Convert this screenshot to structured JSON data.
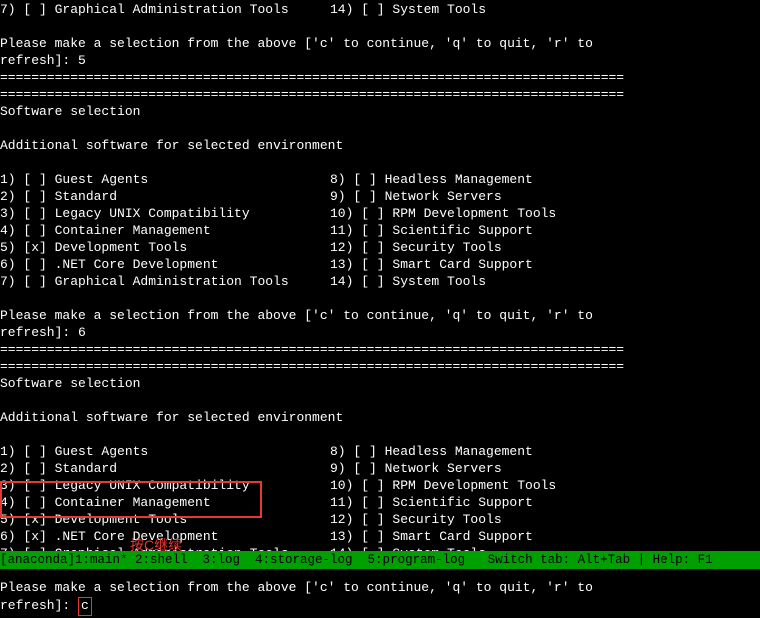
{
  "top_fragment": {
    "item7": "7) [ ] Graphical Administration Tools",
    "item14": "14) [ ] System Tools"
  },
  "prompt_line1": "Please make a selection from the above ['c' to continue, 'q' to quit, 'r' to",
  "prompt_refresh5": "refresh]: 5",
  "prompt_refresh6": "refresh]: 6",
  "prompt_refresh_c": "refresh]: ",
  "cursor_c": "c",
  "divider": "================================================================================",
  "section_title": "Software selection",
  "section_subtitle": "Additional software for selected environment",
  "list1": {
    "left": [
      "1) [ ] Guest Agents",
      "2) [ ] Standard",
      "3) [ ] Legacy UNIX Compatibility",
      "4) [ ] Container Management",
      "5) [x] Development Tools",
      "6) [ ] .NET Core Development",
      "7) [ ] Graphical Administration Tools"
    ],
    "right": [
      "8) [ ] Headless Management",
      "9) [ ] Network Servers",
      "10) [ ] RPM Development Tools",
      "11) [ ] Scientific Support",
      "12) [ ] Security Tools",
      "13) [ ] Smart Card Support",
      "14) [ ] System Tools"
    ]
  },
  "list2": {
    "left": [
      "1) [ ] Guest Agents",
      "2) [ ] Standard",
      "3) [ ] Legacy UNIX Compatibility",
      "4) [ ] Container Management",
      "5) [x] Development Tools",
      "6) [x] .NET Core Development",
      "7) [ ] Graphical Administration Tools"
    ],
    "right": [
      "8) [ ] Headless Management",
      "9) [ ] Network Servers",
      "10) [ ] RPM Development Tools",
      "11) [ ] Scientific Support",
      "12) [ ] Security Tools",
      "13) [ ] Smart Card Support",
      "14) [ ] System Tools"
    ]
  },
  "annotation_text": "按C继续",
  "status": "[anaconda]1:main* 2:shell  3:log  4:storage-log  5:program-log   Switch tab: Alt+Tab | Help: F1"
}
